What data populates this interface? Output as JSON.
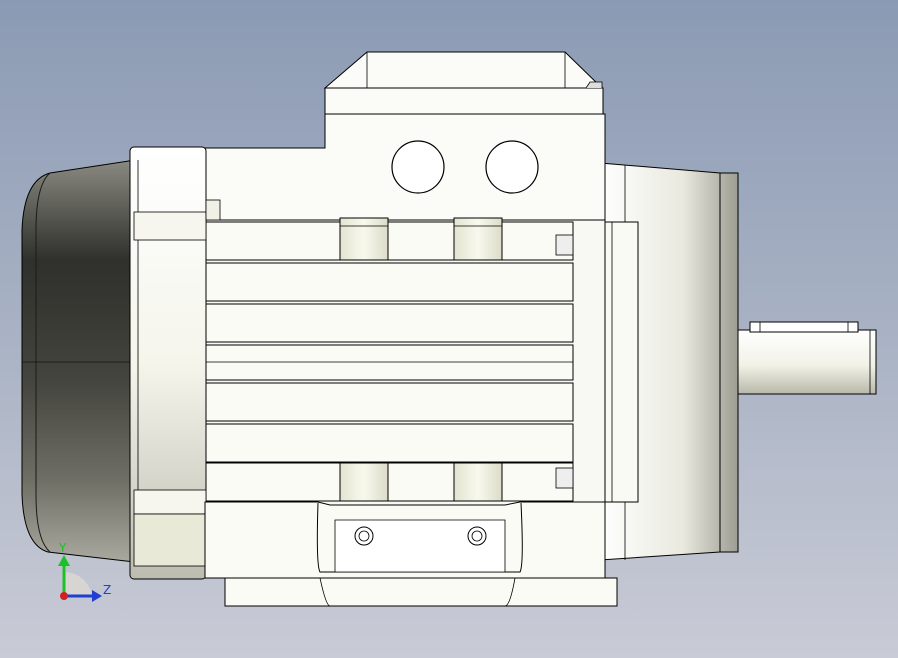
{
  "viewport": {
    "background_top": "#8b9ab4",
    "background_bottom": "#c9cbd6"
  },
  "model": {
    "type": "three-phase electric motor",
    "view": "side elevation",
    "line_color": "#000000",
    "body_color": "#f7f7f2",
    "fan_cover_color": "#3a3a36"
  },
  "triad": {
    "y_label": "Y",
    "z_label": "Z",
    "y_color": "#1fbf2a",
    "z_color": "#1f3fd0",
    "x_color": "#d02020"
  }
}
